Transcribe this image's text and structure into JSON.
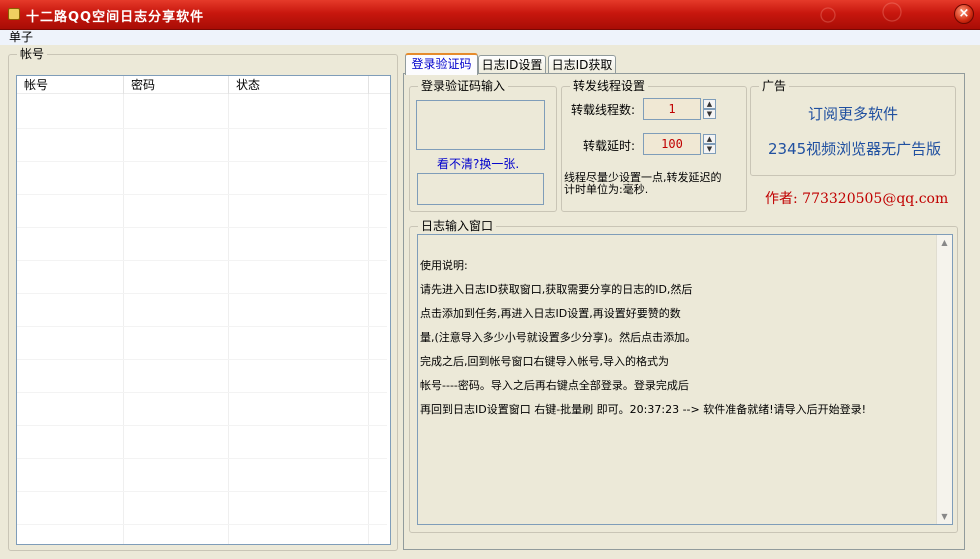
{
  "window": {
    "title": "十二路QQ空间日志分享软件",
    "close_glyph": "×"
  },
  "menu": {
    "items": [
      "单子"
    ]
  },
  "accounts": {
    "group_label": "帐号",
    "columns": [
      "帐号",
      "密码",
      "状态"
    ]
  },
  "tabs": [
    "登录验证码",
    "日志ID设置",
    "日志ID获取"
  ],
  "captcha": {
    "group_label": "登录验证码输入",
    "refresh_link": "看不清?换一张."
  },
  "thread": {
    "group_label": "转发线程设置",
    "count_label": "转载线程数:",
    "count_value": "1",
    "delay_label": "转载延时:",
    "delay_value": "100",
    "note_line1": "线程尽量少设置一点,转发延迟的",
    "note_line2": "计时单位为:毫秒."
  },
  "ad": {
    "group_label": "广告",
    "line1": "订阅更多软件",
    "line2": "2345视频浏览器无广告版",
    "author": "作者: 773320505@qq.com"
  },
  "log": {
    "group_label": "日志输入窗口",
    "lines": [
      "使用说明:",
      "请先进入日志ID获取窗口,获取需要分享的日志的ID,然后",
      "点击添加到任务,再进入日志ID设置,再设置好要赞的数",
      "量,(注意导入多少小号就设置多少分享)。然后点击添加。",
      "完成之后,回到帐号窗口右键导入帐号,导入的格式为",
      "帐号----密码。导入之后再右键点全部登录。登录完成后",
      "再回到日志ID设置窗口 右键-批量刷 即可。20:37:23 --> 软件准备就绪!请导入后开始登录!"
    ]
  },
  "colors": {
    "title_bar": "#c8170e",
    "active_tab_accent": "#e68b2c",
    "link": "#0000cc",
    "author": "#c00000"
  }
}
